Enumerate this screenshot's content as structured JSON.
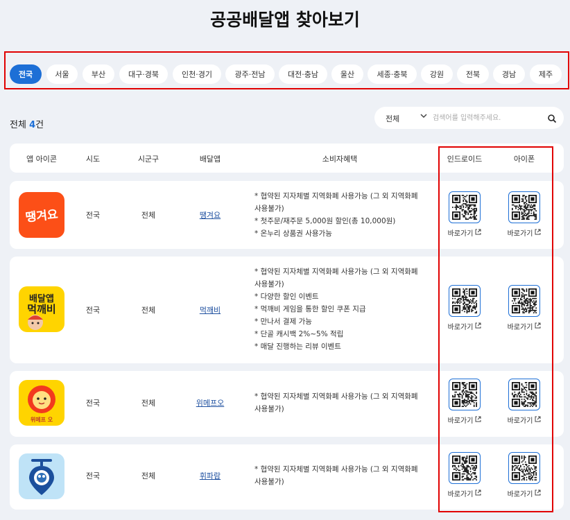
{
  "page_title": "공공배달앱 찾아보기",
  "regions": [
    {
      "label": "전국",
      "active": true
    },
    {
      "label": "서울",
      "active": false
    },
    {
      "label": "부산",
      "active": false
    },
    {
      "label": "대구·경북",
      "active": false
    },
    {
      "label": "인천·경기",
      "active": false
    },
    {
      "label": "광주·전남",
      "active": false
    },
    {
      "label": "대전·충남",
      "active": false
    },
    {
      "label": "울산",
      "active": false
    },
    {
      "label": "세종·충북",
      "active": false
    },
    {
      "label": "강원",
      "active": false
    },
    {
      "label": "전북",
      "active": false
    },
    {
      "label": "경남",
      "active": false
    },
    {
      "label": "제주",
      "active": false
    }
  ],
  "result": {
    "prefix": "전체",
    "count": "4",
    "suffix": "건"
  },
  "search": {
    "select_value": "전체",
    "placeholder": "검색어를 입력해주세요."
  },
  "columns": [
    "앱 아이콘",
    "시도",
    "시군구",
    "배달앱",
    "소비자혜택",
    "인드로이드",
    "아이폰"
  ],
  "rows": [
    {
      "sido": "전국",
      "sigungu": "전체",
      "app": "땡겨요",
      "icon": "ddanggyeoyo-logo-icon",
      "benefits": [
        "* 협약된 지자체별 지역화폐 사용가능 (그 외 지역화폐",
        "사용불가)",
        "* 첫주문/재주문 5,000원 할인(총 10,000원)",
        "* 온누리 상품권 사용가능"
      ],
      "android_label": "바로가기",
      "ios_label": "바로가기"
    },
    {
      "sido": "전국",
      "sigungu": "전체",
      "app": "먹깨비",
      "icon": "meokkaebi-logo-icon",
      "benefits": [
        "* 협약된 지자체별 지역화폐 사용가능 (그 외 지역화폐",
        "사용불가)",
        "* 다양한 할인 이벤트",
        "* 먹깨비 게임을 통한 할인 쿠폰 지급",
        "* 만나서 결제 가능",
        "* 단골 캐시백 2%~5% 적립",
        "* 매달 진행하는 리뷰 이벤트"
      ],
      "android_label": "바로가기",
      "ios_label": "바로가기"
    },
    {
      "sido": "전국",
      "sigungu": "전체",
      "app": "위메프오",
      "icon": "wemakeprice-o-logo-icon",
      "icon_caption": "위메프 오",
      "benefits": [
        "* 협약된 지자체별 지역화폐 사용가능 (그 외 지역화폐",
        "사용불가)"
      ],
      "android_label": "바로가기",
      "ios_label": "바로가기"
    },
    {
      "sido": "전국",
      "sigungu": "전체",
      "app": "휘파람",
      "icon": "hwiparam-logo-icon",
      "benefits": [
        "* 협약된 지자체별 지역화폐 사용가능 (그 외 지역화폐",
        "사용불가)"
      ],
      "android_label": "바로가기",
      "ios_label": "바로가기"
    }
  ],
  "colors": {
    "accent": "#1d6fd6",
    "background": "#eef1f6",
    "highlight_border": "#e10000"
  }
}
